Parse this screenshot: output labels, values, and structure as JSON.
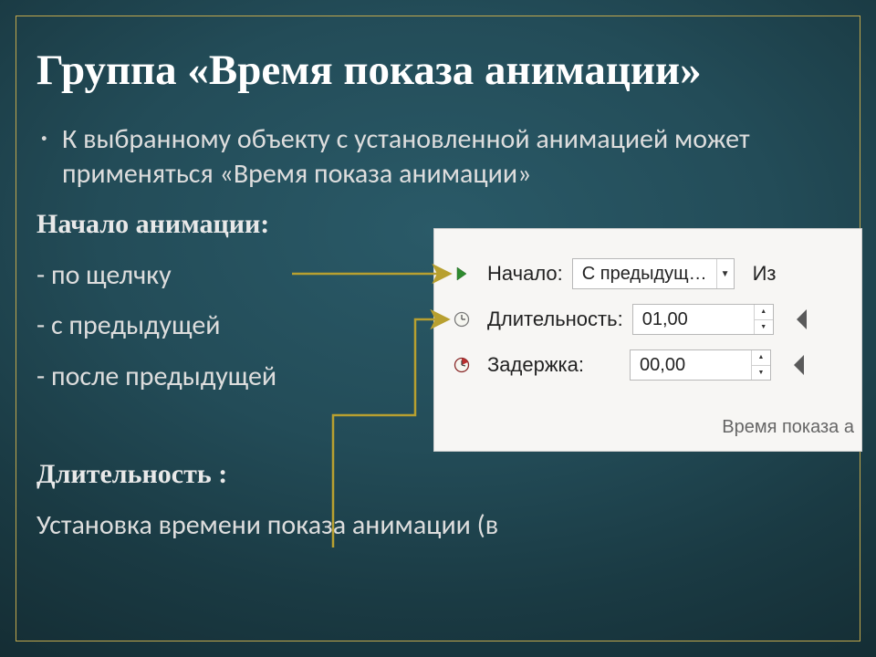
{
  "title": "Группа «Время показа анимации»",
  "intro": "К выбранному объекту с установленной анимацией может применяться «Время показа анимации»",
  "start_heading": "Начало анимации:",
  "start_options": [
    "- по щелчку",
    "- с предыдущей",
    "- после предыдущей"
  ],
  "duration_heading": "Длительность :",
  "duration_text": "Установка времени показа анимации (в",
  "panel": {
    "start_label": "Начало:",
    "start_value": "С предыдущ…",
    "duration_label": "Длительность:",
    "duration_value": "01,00",
    "delay_label": "Задержка:",
    "delay_value": "00,00",
    "right_cut": "Из",
    "caption": "Время показа а"
  }
}
